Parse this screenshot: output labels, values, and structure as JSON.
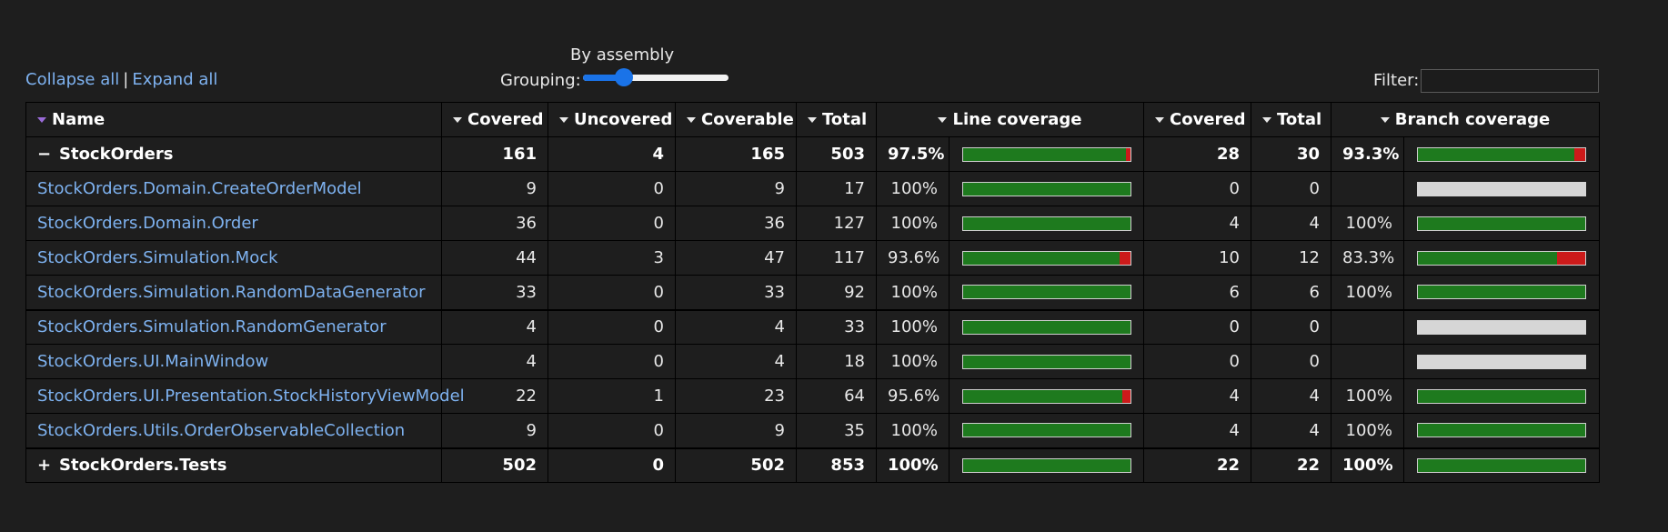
{
  "toolbar": {
    "collapse_all": "Collapse all",
    "separator": "|",
    "expand_all": "Expand all",
    "grouping_label": "Grouping:",
    "grouping_value": "By assembly",
    "grouping_level": 0.25,
    "filter_label": "Filter:",
    "filter_value": ""
  },
  "columns": {
    "name": "Name",
    "covered": "Covered",
    "uncovered": "Uncovered",
    "coverable": "Coverable",
    "total": "Total",
    "line_coverage": "Line coverage",
    "branch_covered": "Covered",
    "branch_total": "Total",
    "branch_coverage": "Branch coverage"
  },
  "colors": {
    "covered": "#1e7a1e",
    "uncovered": "#cc1a1a",
    "na": "#d6d6d6",
    "link": "#7eb2f0",
    "sort_active": "#9a6bd8"
  },
  "groups": [
    {
      "toggle": "−",
      "name": "StockOrders",
      "covered": "161",
      "uncovered": "4",
      "coverable": "165",
      "total": "503",
      "line_pct": "97.5%",
      "line_fraction": 0.975,
      "branch_covered": "28",
      "branch_total": "30",
      "branch_pct": "93.3%",
      "branch_fraction": 0.933,
      "classes": [
        {
          "name": "StockOrders.Domain.CreateOrderModel",
          "covered": "9",
          "uncovered": "0",
          "coverable": "9",
          "total": "17",
          "line_pct": "100%",
          "line_fraction": 1.0,
          "branch_covered": "0",
          "branch_total": "0",
          "branch_pct": "",
          "branch_fraction": null
        },
        {
          "name": "StockOrders.Domain.Order",
          "covered": "36",
          "uncovered": "0",
          "coverable": "36",
          "total": "127",
          "line_pct": "100%",
          "line_fraction": 1.0,
          "branch_covered": "4",
          "branch_total": "4",
          "branch_pct": "100%",
          "branch_fraction": 1.0
        },
        {
          "name": "StockOrders.Simulation.Mock",
          "covered": "44",
          "uncovered": "3",
          "coverable": "47",
          "total": "117",
          "line_pct": "93.6%",
          "line_fraction": 0.936,
          "branch_covered": "10",
          "branch_total": "12",
          "branch_pct": "83.3%",
          "branch_fraction": 0.833
        },
        {
          "name": "StockOrders.Simulation.RandomDataGenerator",
          "covered": "33",
          "uncovered": "0",
          "coverable": "33",
          "total": "92",
          "line_pct": "100%",
          "line_fraction": 1.0,
          "branch_covered": "6",
          "branch_total": "6",
          "branch_pct": "100%",
          "branch_fraction": 1.0
        },
        {
          "name": "StockOrders.Simulation.RandomGenerator",
          "covered": "4",
          "uncovered": "0",
          "coverable": "4",
          "total": "33",
          "line_pct": "100%",
          "line_fraction": 1.0,
          "branch_covered": "0",
          "branch_total": "0",
          "branch_pct": "",
          "branch_fraction": null
        },
        {
          "name": "StockOrders.UI.MainWindow",
          "covered": "4",
          "uncovered": "0",
          "coverable": "4",
          "total": "18",
          "line_pct": "100%",
          "line_fraction": 1.0,
          "branch_covered": "0",
          "branch_total": "0",
          "branch_pct": "",
          "branch_fraction": null
        },
        {
          "name": "StockOrders.UI.Presentation.StockHistoryViewModel",
          "covered": "22",
          "uncovered": "1",
          "coverable": "23",
          "total": "64",
          "line_pct": "95.6%",
          "line_fraction": 0.956,
          "branch_covered": "4",
          "branch_total": "4",
          "branch_pct": "100%",
          "branch_fraction": 1.0
        },
        {
          "name": "StockOrders.Utils.OrderObservableCollection",
          "covered": "9",
          "uncovered": "0",
          "coverable": "9",
          "total": "35",
          "line_pct": "100%",
          "line_fraction": 1.0,
          "branch_covered": "4",
          "branch_total": "4",
          "branch_pct": "100%",
          "branch_fraction": 1.0
        }
      ]
    },
    {
      "toggle": "+",
      "name": "StockOrders.Tests",
      "covered": "502",
      "uncovered": "0",
      "coverable": "502",
      "total": "853",
      "line_pct": "100%",
      "line_fraction": 1.0,
      "branch_covered": "22",
      "branch_total": "22",
      "branch_pct": "100%",
      "branch_fraction": 1.0,
      "classes": []
    }
  ]
}
